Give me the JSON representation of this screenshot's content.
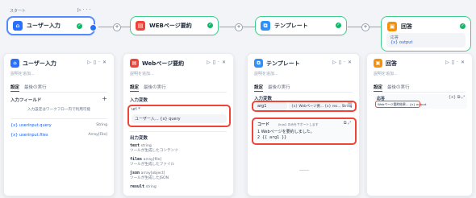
{
  "canvas": {
    "start_label": "スタート",
    "nodes": [
      {
        "title": "ユーザー入力",
        "icon": "user-icon",
        "color": "#2970ff"
      },
      {
        "title": "WEBページ要約",
        "icon": "web-summary-icon",
        "color": "#f04438"
      },
      {
        "title": "テンプレート",
        "icon": "template-icon",
        "color": "#2e90fa"
      },
      {
        "title": "回答",
        "icon": "answer-icon",
        "color": "#f79009",
        "output_label": "応答",
        "output_var": "{x} output"
      }
    ]
  },
  "panels": {
    "user_input": {
      "title": "ユーザー入力",
      "desc": "説明を追加...",
      "tab_settings": "設定",
      "tab_last_run": "最後の実行",
      "section": "入力フィールド",
      "empty_hint": "入力設定はワークフロー内で利用可能",
      "vars": [
        {
          "name": "{x} userinput.query",
          "type": "String"
        },
        {
          "name": "{x} userinput.files",
          "type": "Array[File]"
        }
      ]
    },
    "web_summary": {
      "title": "Webページ要約",
      "desc": "説明を追加...",
      "tab_settings": "設定",
      "tab_last_run": "最後の実行",
      "section": "入力変数",
      "url_label": "url *",
      "url_value": "ユーザー入... {x} query",
      "output_section": "出力変数",
      "outputs": [
        {
          "name": "text",
          "type": "string",
          "desc": "ツールが生成したコンテンツ"
        },
        {
          "name": "files",
          "type": "array[file]",
          "desc": "ツールが生成したファイル"
        },
        {
          "name": "json",
          "type": "array[object]",
          "desc": "ツールが生成したJSON"
        },
        {
          "name": "result",
          "type": "string",
          "desc": ""
        }
      ]
    },
    "template": {
      "title": "テンプレート",
      "desc": "説明を追加...",
      "tab_settings": "設定",
      "tab_last_run": "最後の実行",
      "section": "入力変数",
      "var_name": "arg1",
      "var_value": "{x} Webページ要... {x} res... String",
      "code_label": "コード",
      "code_hint": "Jinja2 のみをサポートします",
      "code_lines": [
        "1   Webページを要約しました。",
        "2   {{ arg1 }}"
      ]
    },
    "answer": {
      "title": "回答",
      "desc": "説明を追加...",
      "tab_settings": "設定",
      "tab_last_run": "最後の実行",
      "section": "応答",
      "value": "Webページ要約結果... {x} output"
    }
  }
}
